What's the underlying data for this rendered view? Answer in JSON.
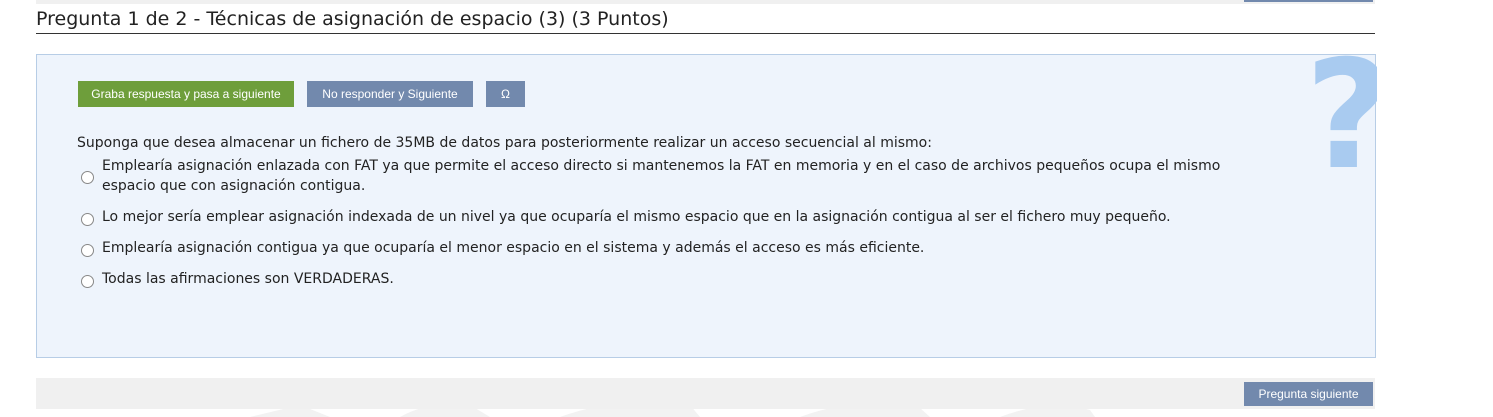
{
  "question": {
    "title": "Pregunta 1 de 2 - Técnicas de asignación de espacio (3) (3 Puntos)",
    "prompt": "Suponga que desea almacenar un fichero de 35MB de datos para posteriormente realizar un acceso secuencial al mismo:",
    "help_symbol": "?"
  },
  "toolbar": {
    "save_label": "Graba respuesta y pasa a siguiente",
    "skip_label": "No responder y Siguiente",
    "omega_label": "Ω"
  },
  "options": [
    {
      "text": "Emplearía asignación enlazada con FAT ya que permite el acceso directo si mantenemos la FAT en memoria y en el caso de archivos pequeños ocupa el mismo espacio que con asignación contigua.",
      "selected": false
    },
    {
      "text": "Lo mejor sería emplear asignación indexada de un nivel ya que ocuparía el mismo espacio que en la asignación contigua al ser el fichero muy pequeño.",
      "selected": false
    },
    {
      "text": "Emplearía asignación contigua ya que ocuparía el menor espacio en el sistema y además el acceso es más eficiente.",
      "selected": false
    },
    {
      "text": "Todas las afirmaciones son VERDADERAS.",
      "selected": false
    }
  ],
  "footer": {
    "next_label": "Pregunta siguiente"
  },
  "colors": {
    "primary_button": "#6e9e3b",
    "secondary_button": "#7289ad",
    "panel_background": "#eef4fc",
    "panel_border": "#b7cde6",
    "help_symbol": "#a9cbf0"
  }
}
